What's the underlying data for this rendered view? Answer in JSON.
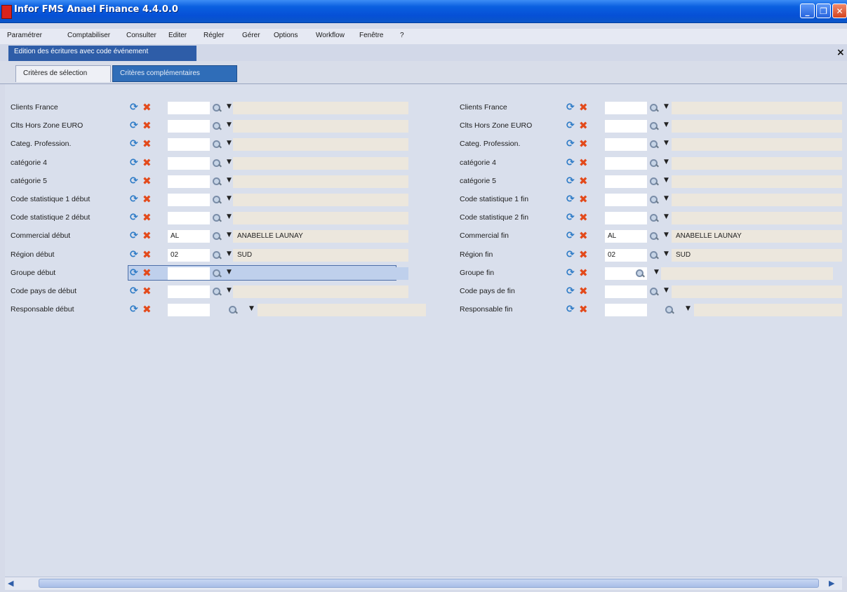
{
  "window": {
    "title": "Infor FMS Anael Finance 4.4.0.0",
    "minimize": "_",
    "maximize": "❐",
    "close": "✕"
  },
  "menu": [
    "Paramétrer",
    "Comptabiliser",
    "Consulter",
    "Editer",
    "Régler",
    "Gérer",
    "Options",
    "Workflow",
    "Fenêtre",
    "?"
  ],
  "document_tab": {
    "label": "Edition des écritures avec code événement",
    "close": "×"
  },
  "tabs": [
    "Critères de sélection",
    "Critères complémentaires"
  ],
  "active_tab": "Critères complémentaires",
  "left_fields": [
    {
      "label": "Clients France",
      "code": "",
      "description": ""
    },
    {
      "label": "Clts Hors Zone EURO",
      "code": "",
      "description": ""
    },
    {
      "label": "Categ. Profession.",
      "code": "",
      "description": ""
    },
    {
      "label": "catégorie 4",
      "code": "",
      "description": ""
    },
    {
      "label": "catégorie 5",
      "code": "",
      "description": ""
    },
    {
      "label": "Code statistique 1 début",
      "code": "",
      "description": ""
    },
    {
      "label": "Code statistique 2 début",
      "code": "",
      "description": ""
    },
    {
      "label": "Commercial début",
      "code": "AL",
      "description": "ANABELLE LAUNAY"
    },
    {
      "label": "Région début",
      "code": "02",
      "description": "SUD"
    },
    {
      "label": "Groupe début",
      "code": "",
      "description": ""
    },
    {
      "label": "Code pays de début",
      "code": "",
      "description": ""
    },
    {
      "label": "Responsable début",
      "code": "",
      "description": ""
    }
  ],
  "right_fields": [
    {
      "label": "Clients France",
      "code": "",
      "description": ""
    },
    {
      "label": "Clts Hors Zone EURO",
      "code": "",
      "description": ""
    },
    {
      "label": "Categ. Profession.",
      "code": "",
      "description": ""
    },
    {
      "label": "catégorie 4",
      "code": "",
      "description": ""
    },
    {
      "label": "catégorie 5",
      "code": "",
      "description": ""
    },
    {
      "label": "Code statistique 1 fin",
      "code": "",
      "description": ""
    },
    {
      "label": "Code statistique 2 fin",
      "code": "",
      "description": ""
    },
    {
      "label": "Commercial fin",
      "code": "AL",
      "description": "ANABELLE LAUNAY"
    },
    {
      "label": "Région fin",
      "code": "02",
      "description": "SUD"
    },
    {
      "label": "Groupe fin",
      "code": "",
      "description": ""
    },
    {
      "label": "Code pays de fin",
      "code": "",
      "description": ""
    },
    {
      "label": "Responsable fin",
      "code": "",
      "description": ""
    }
  ],
  "icons": {
    "refresh": "refresh-icon",
    "delete": "delete-icon",
    "search": "search-icon",
    "dropdown": "chevron-down-icon"
  },
  "scrollbar": {
    "left": "◀",
    "right": "▶"
  },
  "colors": {
    "titlebar": "#0650d6",
    "active_tab": "#2f6db8",
    "desc_field": "#ece7dd"
  }
}
